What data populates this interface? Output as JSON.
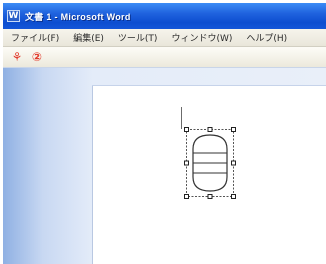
{
  "window": {
    "title": "文書 1 - Microsoft Word",
    "app_icon": "word-icon"
  },
  "menu": {
    "items": [
      "ファイル(F)",
      "編集(E)",
      "ツール(T)",
      "ウィンドウ(W)",
      "ヘルプ(H)"
    ]
  },
  "toolbar": {
    "tools": [
      {
        "icon": "shape-tool-icon",
        "glyph": "⚘"
      },
      {
        "icon": "circle-number-tool-icon",
        "glyph": "②"
      }
    ],
    "accent_color": "#e23a2c"
  },
  "document": {
    "selected_object": "rounded-shape-with-horizontal-lines"
  },
  "colors": {
    "titlebar": "#1f62de",
    "workspace": "#dbe6f5",
    "page": "#ffffff"
  }
}
